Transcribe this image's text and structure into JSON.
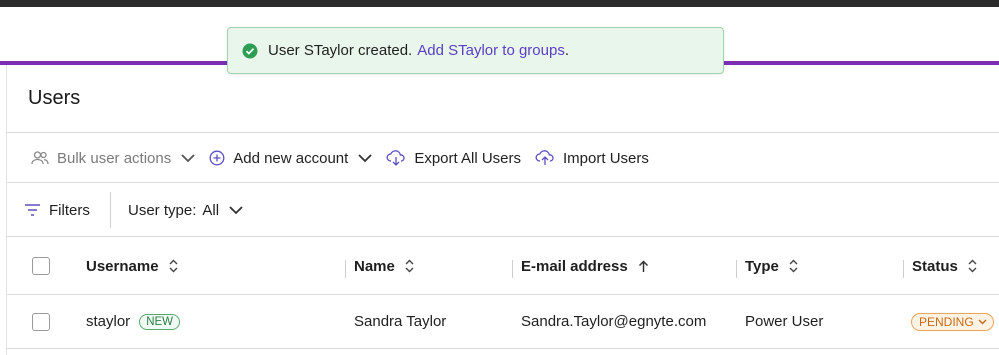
{
  "toast": {
    "message": "User STaylor created.",
    "link": "Add STaylor to groups",
    "suffix": "."
  },
  "page": {
    "title": "Users"
  },
  "toolbar": {
    "bulk_actions": "Bulk user actions",
    "add_account": "Add new account",
    "export": "Export All Users",
    "import": "Import Users"
  },
  "filterbar": {
    "filters": "Filters",
    "user_type_label": "User type:",
    "user_type_value": "All"
  },
  "table": {
    "columns": {
      "username": "Username",
      "name": "Name",
      "email": "E-mail address",
      "type": "Type",
      "status": "Status"
    },
    "rows": [
      {
        "username": "staylor",
        "badge": "NEW",
        "name": "Sandra Taylor",
        "email": "Sandra.Taylor@egnyte.com",
        "type": "Power User",
        "status": "PENDING"
      }
    ]
  },
  "colors": {
    "accent": "#7b2fb5",
    "link": "#5b3fc4",
    "success": "#2e9e55",
    "pending": "#c96a12"
  }
}
